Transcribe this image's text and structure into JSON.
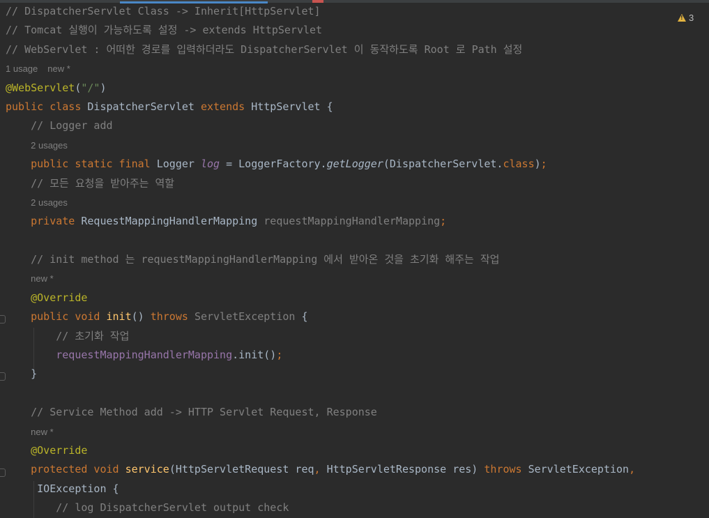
{
  "editor": {
    "warnings_count": "3",
    "lines": [
      {
        "kind": "code",
        "indent": "",
        "tokens": [
          {
            "t": "// DispatcherServlet Class -> Inherit[HttpServlet]",
            "c": "cm"
          }
        ]
      },
      {
        "kind": "code",
        "indent": "",
        "tokens": [
          {
            "t": "// Tomcat 실행이 가능하도록 설정 -> extends HttpServlet",
            "c": "cm"
          }
        ]
      },
      {
        "kind": "code",
        "indent": "",
        "tokens": [
          {
            "t": "// WebServlet : 어떠한 경로를 입력하더라도 DispatcherServlet 이 동작하도록 Root 로 Path 설정",
            "c": "cm"
          }
        ]
      },
      {
        "kind": "hint",
        "items": [
          "1 usage",
          "new *"
        ]
      },
      {
        "kind": "code",
        "indent": "",
        "tokens": [
          {
            "t": "@WebServlet",
            "c": "an"
          },
          {
            "t": "(",
            "c": "pl"
          },
          {
            "t": "\"/\"",
            "c": "st"
          },
          {
            "t": ")",
            "c": "pl"
          }
        ]
      },
      {
        "kind": "code",
        "indent": "",
        "tokens": [
          {
            "t": "public class ",
            "c": "kw"
          },
          {
            "t": "DispatcherServlet ",
            "c": "pl"
          },
          {
            "t": "extends ",
            "c": "kw"
          },
          {
            "t": "HttpServlet {",
            "c": "pl"
          }
        ]
      },
      {
        "kind": "code",
        "indent": "    ",
        "tokens": [
          {
            "t": "// Logger add",
            "c": "cm"
          }
        ]
      },
      {
        "kind": "hint",
        "indent": "    ",
        "items": [
          "2 usages"
        ]
      },
      {
        "kind": "code",
        "indent": "    ",
        "tokens": [
          {
            "t": "public static final ",
            "c": "kw"
          },
          {
            "t": "Logger ",
            "c": "pl"
          },
          {
            "t": "log",
            "c": "sf"
          },
          {
            "t": " = LoggerFactory.",
            "c": "pl"
          },
          {
            "t": "getLogger",
            "c": "it"
          },
          {
            "t": "(DispatcherServlet.",
            "c": "pl"
          },
          {
            "t": "class",
            "c": "kw"
          },
          {
            "t": ")",
            "c": "pl"
          },
          {
            "t": ";",
            "c": "kw"
          }
        ]
      },
      {
        "kind": "code",
        "indent": "    ",
        "tokens": [
          {
            "t": "// 모든 요청을 받아주는 역할",
            "c": "cm"
          }
        ]
      },
      {
        "kind": "hint",
        "indent": "    ",
        "items": [
          "2 usages"
        ]
      },
      {
        "kind": "code",
        "indent": "    ",
        "tokens": [
          {
            "t": "private ",
            "c": "kw"
          },
          {
            "t": "RequestMappingHandlerMapping ",
            "c": "pl"
          },
          {
            "t": "requestMappingHandlerMapping",
            "c": "unused"
          },
          {
            "t": ";",
            "c": "kw"
          }
        ]
      },
      {
        "kind": "blank"
      },
      {
        "kind": "code",
        "indent": "    ",
        "tokens": [
          {
            "t": "// init method 는 requestMappingHandlerMapping 에서 받아온 것을 초기화 해주는 작업",
            "c": "cm"
          }
        ]
      },
      {
        "kind": "hint",
        "indent": "    ",
        "items": [
          "new *"
        ]
      },
      {
        "kind": "code",
        "indent": "    ",
        "tokens": [
          {
            "t": "@Override",
            "c": "an"
          }
        ]
      },
      {
        "kind": "code",
        "indent": "    ",
        "tokens": [
          {
            "t": "public void ",
            "c": "kw"
          },
          {
            "t": "init",
            "c": "fn"
          },
          {
            "t": "() ",
            "c": "pl"
          },
          {
            "t": "throws ",
            "c": "kw"
          },
          {
            "t": "ServletException",
            "c": "unused"
          },
          {
            "t": " {",
            "c": "pl"
          }
        ]
      },
      {
        "kind": "code",
        "indent": "        ",
        "tokens": [
          {
            "t": "// 초기화 작업",
            "c": "cm"
          }
        ]
      },
      {
        "kind": "code",
        "indent": "        ",
        "tokens": [
          {
            "t": "requestMappingHandlerMapping",
            "c": "fd"
          },
          {
            "t": ".init()",
            "c": "pl"
          },
          {
            "t": ";",
            "c": "kw"
          }
        ]
      },
      {
        "kind": "code",
        "indent": "    ",
        "tokens": [
          {
            "t": "}",
            "c": "pl"
          }
        ]
      },
      {
        "kind": "blank"
      },
      {
        "kind": "code",
        "indent": "    ",
        "tokens": [
          {
            "t": "// Service Method add -> HTTP Servlet Request, Response",
            "c": "cm"
          }
        ]
      },
      {
        "kind": "hint",
        "indent": "    ",
        "items": [
          "new *"
        ]
      },
      {
        "kind": "code",
        "indent": "    ",
        "tokens": [
          {
            "t": "@Override",
            "c": "an"
          }
        ]
      },
      {
        "kind": "code",
        "indent": "    ",
        "tokens": [
          {
            "t": "protected void ",
            "c": "kw"
          },
          {
            "t": "service",
            "c": "fn"
          },
          {
            "t": "(HttpServletRequest req",
            "c": "pl"
          },
          {
            "t": ", ",
            "c": "kw"
          },
          {
            "t": "HttpServletResponse res) ",
            "c": "pl"
          },
          {
            "t": "throws ",
            "c": "kw"
          },
          {
            "t": "ServletException",
            "c": "pl"
          },
          {
            "t": ",",
            "c": "kw"
          }
        ]
      },
      {
        "kind": "code",
        "indent": "     ",
        "tokens": [
          {
            "t": "IOException {",
            "c": "pl"
          }
        ]
      },
      {
        "kind": "code",
        "indent": "        ",
        "tokens": [
          {
            "t": "// log DispatcherServlet output check",
            "c": "cm"
          }
        ]
      }
    ]
  }
}
